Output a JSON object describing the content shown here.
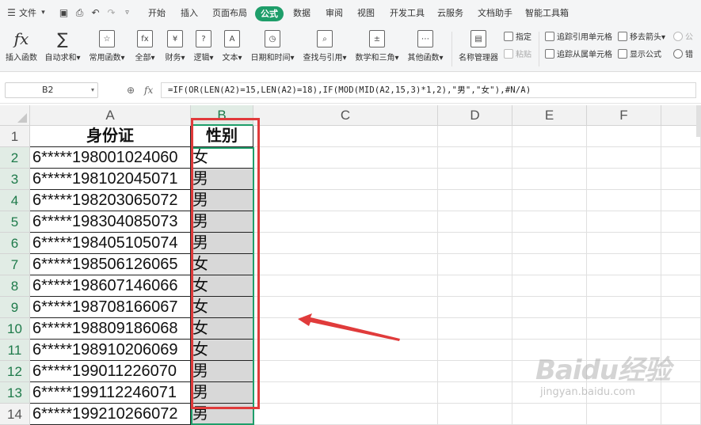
{
  "menubar": {
    "file_label": "文件",
    "tabs": [
      {
        "label": "开始"
      },
      {
        "label": "插入"
      },
      {
        "label": "页面布局"
      },
      {
        "label": "公式"
      },
      {
        "label": "数据"
      },
      {
        "label": "审阅"
      },
      {
        "label": "视图"
      },
      {
        "label": "开发工具"
      },
      {
        "label": "云服务"
      },
      {
        "label": "文档助手"
      },
      {
        "label": "智能工具箱"
      }
    ],
    "active_tab": "公式",
    "accent_color": "#1e9e6a"
  },
  "ribbon": {
    "insert_function": {
      "label": "插入函数",
      "icon": "fx-icon"
    },
    "autosum": {
      "label": "自动求和▾",
      "icon": "sigma-icon"
    },
    "common": {
      "label": "常用函数▾"
    },
    "all": {
      "label": "全部▾"
    },
    "finance": {
      "label": "财务▾",
      "glyph": "¥"
    },
    "logic": {
      "label": "逻辑▾",
      "glyph": "?"
    },
    "text": {
      "label": "文本▾",
      "glyph": "A"
    },
    "datetime": {
      "label": "日期和时间▾"
    },
    "lookup": {
      "label": "查找与引用▾"
    },
    "math": {
      "label": "数学和三角▾"
    },
    "other": {
      "label": "其他函数▾"
    },
    "name_manager": {
      "label": "名称管理器"
    },
    "specify": {
      "label": "指定"
    },
    "paste": {
      "label": "粘贴"
    },
    "trace_precedents": {
      "label": "追踪引用单元格"
    },
    "trace_dependents": {
      "label": "追踪从属单元格"
    },
    "remove_arrows": {
      "label": "移去箭头▾"
    },
    "show_formulas": {
      "label": "显示公式"
    },
    "extra1": {
      "label": "公"
    },
    "extra2": {
      "label": "错"
    }
  },
  "formula_bar": {
    "name_box": "B2",
    "fx_label": "fx",
    "formula": "=IF(OR(LEN(A2)=15,LEN(A2)=18),IF(MOD(MID(A2,15,3)*1,2),\"男\",\"女\"),#N/A)"
  },
  "grid": {
    "columns": [
      "A",
      "B",
      "C",
      "D",
      "E",
      "F"
    ],
    "selected_column": "B",
    "header_row": {
      "a": "身份证",
      "b": "性别"
    },
    "rows": [
      {
        "num": "1"
      },
      {
        "num": "2",
        "a": "6*****198001024060",
        "b": "女"
      },
      {
        "num": "3",
        "a": "6*****198102045071",
        "b": "男"
      },
      {
        "num": "4",
        "a": "6*****198203065072",
        "b": "男"
      },
      {
        "num": "5",
        "a": "6*****198304085073",
        "b": "男"
      },
      {
        "num": "6",
        "a": "6*****198405105074",
        "b": "男"
      },
      {
        "num": "7",
        "a": "6*****198506126065",
        "b": "女"
      },
      {
        "num": "8",
        "a": "6*****198607146066",
        "b": "女"
      },
      {
        "num": "9",
        "a": "6*****198708166067",
        "b": "女"
      },
      {
        "num": "10",
        "a": "6*****198809186068",
        "b": "女"
      },
      {
        "num": "11",
        "a": "6*****198910206069",
        "b": "女"
      },
      {
        "num": "12",
        "a": "6*****199011226070",
        "b": "男"
      },
      {
        "num": "13",
        "a": "6*****199112246071",
        "b": "男"
      },
      {
        "num": "14",
        "a": "6*****199210266072",
        "b": "男"
      }
    ]
  },
  "annotation": {
    "box_color": "#e03b3b",
    "arrow_color": "#e03b3b"
  },
  "watermark": {
    "logo": "Baidu经验",
    "site": "jingyan.baidu.com"
  }
}
